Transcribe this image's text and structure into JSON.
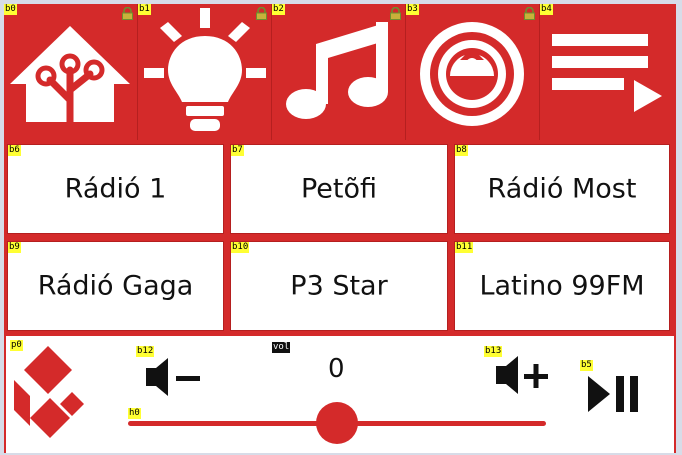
{
  "top_buttons": [
    {
      "tag": "b0",
      "icon": "home-assistant-icon",
      "locked": true
    },
    {
      "tag": "b1",
      "icon": "lightbulb-icon",
      "locked": true
    },
    {
      "tag": "b2",
      "icon": "music-note-icon",
      "locked": true
    },
    {
      "tag": "b3",
      "icon": "speaker-icon",
      "locked": true
    },
    {
      "tag": "b4",
      "icon": "playlist-icon",
      "locked": false
    }
  ],
  "stations": [
    {
      "tag": "b6",
      "label": "Rádió 1"
    },
    {
      "tag": "b7",
      "label": "Petõfi"
    },
    {
      "tag": "b8",
      "label": "Rádió Most"
    },
    {
      "tag": "b9",
      "label": "Rádió Gaga"
    },
    {
      "tag": "b10",
      "label": "P3 Star"
    },
    {
      "tag": "b11",
      "label": "Latino 99FM"
    }
  ],
  "bottom": {
    "logo_tag": "p0",
    "logo_icon": "kodi-logo-icon",
    "vol_down_tag": "b12",
    "vol_down_icon": "volume-down-icon",
    "vol_label_tag": "vol",
    "volume_value": "0",
    "vol_up_tag": "b13",
    "vol_up_icon": "volume-up-icon",
    "play_pause_tag": "b5",
    "play_pause_icon": "play-pause-icon",
    "slider_tag": "h0"
  },
  "colors": {
    "accent": "#d42a2a",
    "tag_bg": "#ffff33",
    "lock": "#6e8f2e"
  }
}
